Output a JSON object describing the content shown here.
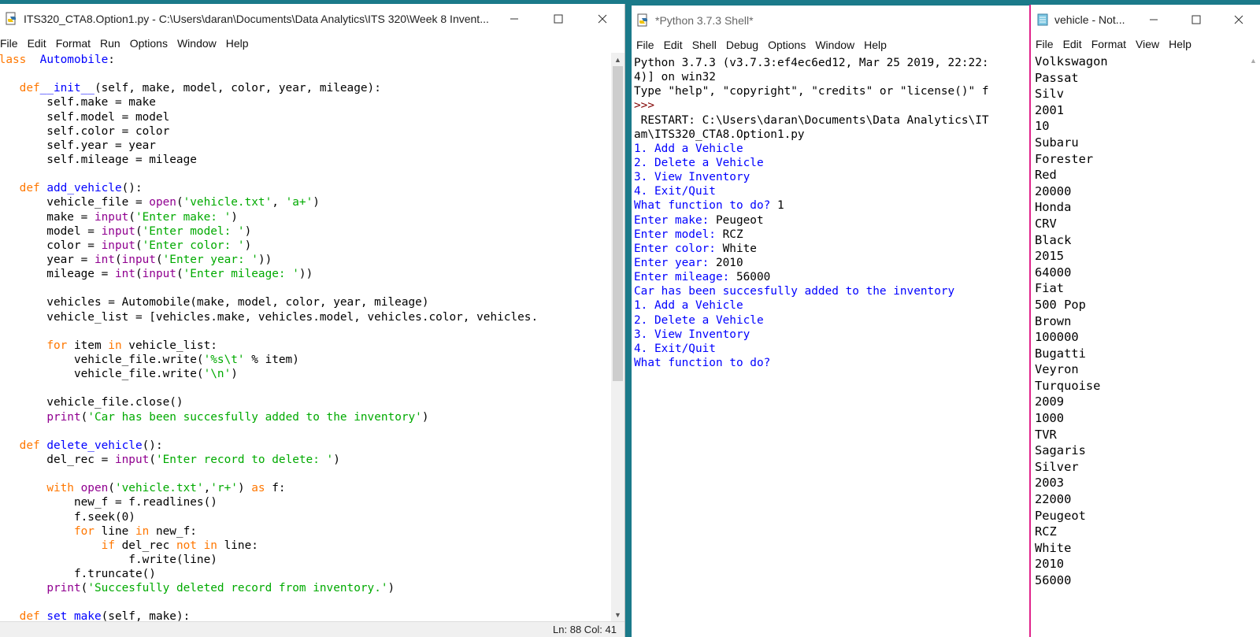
{
  "editor": {
    "title": "ITS320_CTA8.Option1.py - C:\\Users\\daran\\Documents\\Data Analytics\\ITS 320\\Week 8 Invent...",
    "menu": [
      "File",
      "Edit",
      "Format",
      "Run",
      "Options",
      "Window",
      "Help"
    ],
    "status": "Ln: 88   Col: 41",
    "code": [
      [
        [
          "kw",
          "class"
        ],
        [
          "",
          "  "
        ],
        [
          "fn",
          "Automobile"
        ],
        [
          "",
          ":"
        ]
      ],
      [
        [
          "",
          ""
        ]
      ],
      [
        [
          "",
          "    "
        ],
        [
          "kw",
          "def"
        ],
        [
          "",
          ""
        ],
        [
          "fn",
          "__init__"
        ],
        [
          "",
          "(self, make, model, color, year, mileage):"
        ]
      ],
      [
        [
          "",
          "        self.make = make"
        ]
      ],
      [
        [
          "",
          "        self.model = model"
        ]
      ],
      [
        [
          "",
          "        self.color = color"
        ]
      ],
      [
        [
          "",
          "        self.year = year"
        ]
      ],
      [
        [
          "",
          "        self.mileage = mileage"
        ]
      ],
      [
        [
          "",
          ""
        ]
      ],
      [
        [
          "",
          "    "
        ],
        [
          "kw",
          "def"
        ],
        [
          "",
          " "
        ],
        [
          "fn",
          "add_vehicle"
        ],
        [
          "",
          "():"
        ]
      ],
      [
        [
          "",
          "        vehicle_file = "
        ],
        [
          "bi",
          "open"
        ],
        [
          "",
          "("
        ],
        [
          "st",
          "'vehicle.txt'"
        ],
        [
          "",
          ", "
        ],
        [
          "st",
          "'a+'"
        ],
        [
          "",
          ")"
        ]
      ],
      [
        [
          "",
          "        make = "
        ],
        [
          "bi",
          "input"
        ],
        [
          "",
          "("
        ],
        [
          "st",
          "'Enter make: '"
        ],
        [
          "",
          ")"
        ]
      ],
      [
        [
          "",
          "        model = "
        ],
        [
          "bi",
          "input"
        ],
        [
          "",
          "("
        ],
        [
          "st",
          "'Enter model: '"
        ],
        [
          "",
          ")"
        ]
      ],
      [
        [
          "",
          "        color = "
        ],
        [
          "bi",
          "input"
        ],
        [
          "",
          "("
        ],
        [
          "st",
          "'Enter color: '"
        ],
        [
          "",
          ")"
        ]
      ],
      [
        [
          "",
          "        year = "
        ],
        [
          "bi",
          "int"
        ],
        [
          "",
          "("
        ],
        [
          "bi",
          "input"
        ],
        [
          "",
          "("
        ],
        [
          "st",
          "'Enter year: '"
        ],
        [
          "",
          "))"
        ]
      ],
      [
        [
          "",
          "        mileage = "
        ],
        [
          "bi",
          "int"
        ],
        [
          "",
          "("
        ],
        [
          "bi",
          "input"
        ],
        [
          "",
          "("
        ],
        [
          "st",
          "'Enter mileage: '"
        ],
        [
          "",
          "))"
        ]
      ],
      [
        [
          "",
          ""
        ]
      ],
      [
        [
          "",
          "        vehicles = Automobile(make, model, color, year, mileage)"
        ]
      ],
      [
        [
          "",
          "        vehicle_list = [vehicles.make, vehicles.model, vehicles.color, vehicles."
        ]
      ],
      [
        [
          "",
          ""
        ]
      ],
      [
        [
          "",
          "        "
        ],
        [
          "kw",
          "for"
        ],
        [
          "",
          " item "
        ],
        [
          "kw",
          "in"
        ],
        [
          "",
          " vehicle_list:"
        ]
      ],
      [
        [
          "",
          "            vehicle_file.write("
        ],
        [
          "st",
          "'%s\\t'"
        ],
        [
          "",
          " % item)"
        ]
      ],
      [
        [
          "",
          "            vehicle_file.write("
        ],
        [
          "st",
          "'\\n'"
        ],
        [
          "",
          ")"
        ]
      ],
      [
        [
          "",
          ""
        ]
      ],
      [
        [
          "",
          "        vehicle_file.close()"
        ]
      ],
      [
        [
          "",
          "        "
        ],
        [
          "bi",
          "print"
        ],
        [
          "",
          "("
        ],
        [
          "st",
          "'Car has been succesfully added to the inventory'"
        ],
        [
          "",
          ")"
        ]
      ],
      [
        [
          "",
          ""
        ]
      ],
      [
        [
          "",
          "    "
        ],
        [
          "kw",
          "def"
        ],
        [
          "",
          " "
        ],
        [
          "fn",
          "delete_vehicle"
        ],
        [
          "",
          "():"
        ]
      ],
      [
        [
          "",
          "        del_rec = "
        ],
        [
          "bi",
          "input"
        ],
        [
          "",
          "("
        ],
        [
          "st",
          "'Enter record to delete: '"
        ],
        [
          "",
          ")"
        ]
      ],
      [
        [
          "",
          ""
        ]
      ],
      [
        [
          "",
          "        "
        ],
        [
          "kw",
          "with"
        ],
        [
          "",
          " "
        ],
        [
          "bi",
          "open"
        ],
        [
          "",
          "("
        ],
        [
          "st",
          "'vehicle.txt'"
        ],
        [
          "",
          ","
        ],
        [
          "st",
          "'r+'"
        ],
        [
          "",
          ") "
        ],
        [
          "kw",
          "as"
        ],
        [
          "",
          " f:"
        ]
      ],
      [
        [
          "",
          "            new_f = f.readlines()"
        ]
      ],
      [
        [
          "",
          "            f.seek(0)"
        ]
      ],
      [
        [
          "",
          "            "
        ],
        [
          "kw",
          "for"
        ],
        [
          "",
          " line "
        ],
        [
          "kw",
          "in"
        ],
        [
          "",
          " new_f:"
        ]
      ],
      [
        [
          "",
          "                "
        ],
        [
          "kw",
          "if"
        ],
        [
          "",
          " del_rec "
        ],
        [
          "kw",
          "not in"
        ],
        [
          "",
          " line:"
        ]
      ],
      [
        [
          "",
          "                    f.write(line)"
        ]
      ],
      [
        [
          "",
          "            f.truncate()"
        ]
      ],
      [
        [
          "",
          "        "
        ],
        [
          "bi",
          "print"
        ],
        [
          "",
          "("
        ],
        [
          "st",
          "'Succesfully deleted record from inventory.'"
        ],
        [
          "",
          ")"
        ]
      ],
      [
        [
          "",
          ""
        ]
      ],
      [
        [
          "",
          "    "
        ],
        [
          "kw",
          "def"
        ],
        [
          "",
          " "
        ],
        [
          "fn",
          "set_make"
        ],
        [
          "",
          "(self, make):"
        ]
      ]
    ]
  },
  "shell": {
    "title": "*Python 3.7.3 Shell*",
    "menu": [
      "File",
      "Edit",
      "Shell",
      "Debug",
      "Options",
      "Window",
      "Help"
    ],
    "lines": [
      [
        [
          "sin",
          "Python 3.7.3 (v3.7.3:ef4ec6ed12, Mar 25 2019, 22:22:"
        ]
      ],
      [
        [
          "sin",
          "4)] on win32"
        ]
      ],
      [
        [
          "sin",
          "Type \"help\", \"copyright\", \"credits\" or \"license()\" f"
        ]
      ],
      [
        [
          "pr",
          ">>> "
        ]
      ],
      [
        [
          "sin",
          " RESTART: C:\\Users\\daran\\Documents\\Data Analytics\\IT"
        ]
      ],
      [
        [
          "sin",
          "am\\ITS320_CTA8.Option1.py"
        ]
      ],
      [
        [
          "out",
          "1. Add a Vehicle"
        ]
      ],
      [
        [
          "out",
          "2. Delete a Vehicle"
        ]
      ],
      [
        [
          "out",
          "3. View Inventory"
        ]
      ],
      [
        [
          "out",
          "4. Exit/Quit"
        ]
      ],
      [
        [
          "out",
          "What function to do? "
        ],
        [
          "sin",
          "1"
        ]
      ],
      [
        [
          "out",
          "Enter make: "
        ],
        [
          "sin",
          "Peugeot"
        ]
      ],
      [
        [
          "out",
          "Enter model: "
        ],
        [
          "sin",
          "RCZ"
        ]
      ],
      [
        [
          "out",
          "Enter color: "
        ],
        [
          "sin",
          "White"
        ]
      ],
      [
        [
          "out",
          "Enter year: "
        ],
        [
          "sin",
          "2010"
        ]
      ],
      [
        [
          "out",
          "Enter mileage: "
        ],
        [
          "sin",
          "56000"
        ]
      ],
      [
        [
          "out",
          "Car has been succesfully added to the inventory"
        ]
      ],
      [
        [
          "out",
          "1. Add a Vehicle"
        ]
      ],
      [
        [
          "out",
          "2. Delete a Vehicle"
        ]
      ],
      [
        [
          "out",
          "3. View Inventory"
        ]
      ],
      [
        [
          "out",
          "4. Exit/Quit"
        ]
      ],
      [
        [
          "out",
          "What function to do? "
        ]
      ]
    ]
  },
  "notepad": {
    "title": "vehicle - Not...",
    "menu": [
      "File",
      "Edit",
      "Format",
      "View",
      "Help"
    ],
    "lines": [
      "Volkswagon",
      "Passat",
      "Silv",
      "2001",
      "10",
      "Subaru",
      "Forester",
      "Red",
      "20000",
      "Honda",
      "CRV",
      "Black",
      "2015",
      "64000",
      "Fiat",
      "500 Pop",
      "Brown",
      "100000",
      "Bugatti",
      "Veyron",
      "Turquoise",
      "2009",
      "1000",
      "TVR",
      "Sagaris",
      "Silver",
      "2003",
      "22000",
      "Peugeot",
      "RCZ",
      "White",
      "2010",
      "56000"
    ]
  },
  "colors": {
    "keyword": "#ff7700",
    "definition": "#0000ff",
    "builtin": "#900090",
    "string": "#00aa00",
    "shell_output": "#0000ff",
    "notepad_border": "#e0228a"
  },
  "icons": {
    "editor": "python-file-icon",
    "shell": "python-shell-icon",
    "notepad": "notepad-icon"
  }
}
